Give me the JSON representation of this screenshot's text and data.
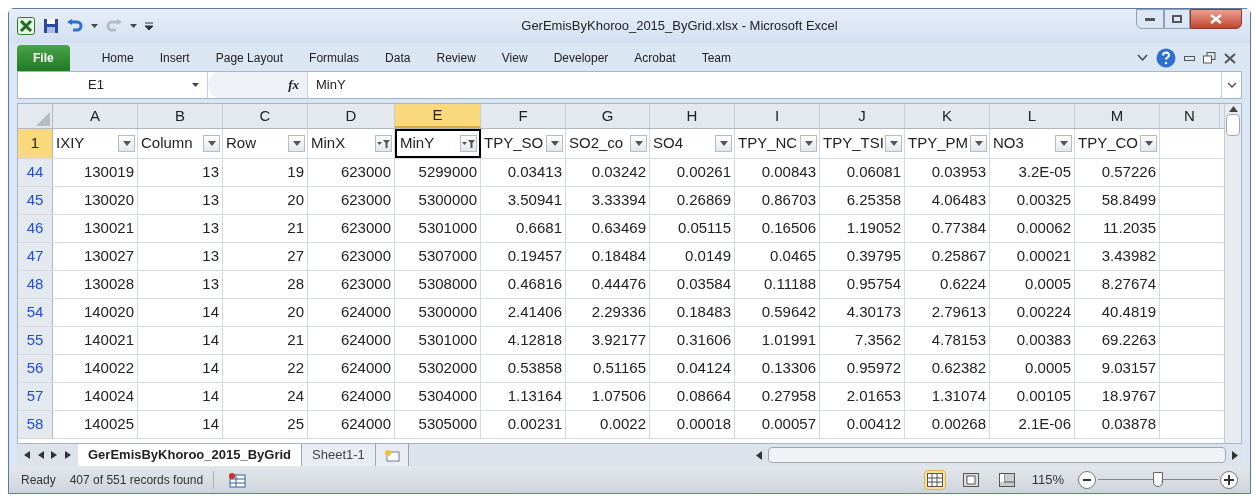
{
  "window": {
    "title": "GerEmisByKhoroo_2015_ByGrid.xlsx  -  Microsoft Excel"
  },
  "ribbon_tabs": [
    {
      "label": "File",
      "kind": "file",
      "selected": false
    },
    {
      "label": "Home",
      "kind": "tab",
      "selected": false
    },
    {
      "label": "Insert",
      "kind": "tab",
      "selected": false
    },
    {
      "label": "Page Layout",
      "kind": "tab",
      "selected": false
    },
    {
      "label": "Formulas",
      "kind": "tab",
      "selected": false
    },
    {
      "label": "Data",
      "kind": "tab",
      "selected": false
    },
    {
      "label": "Review",
      "kind": "tab",
      "selected": false
    },
    {
      "label": "View",
      "kind": "tab",
      "selected": false
    },
    {
      "label": "Developer",
      "kind": "tab",
      "selected": false
    },
    {
      "label": "Acrobat",
      "kind": "tab",
      "selected": false
    },
    {
      "label": "Team",
      "kind": "tab",
      "selected": false
    }
  ],
  "formula_bar": {
    "name_box": "E1",
    "fx": "fx",
    "value": "MinY"
  },
  "columns": [
    {
      "letter": "A",
      "selected": false
    },
    {
      "letter": "B",
      "selected": false
    },
    {
      "letter": "C",
      "selected": false
    },
    {
      "letter": "D",
      "selected": false
    },
    {
      "letter": "E",
      "selected": true
    },
    {
      "letter": "F",
      "selected": false
    },
    {
      "letter": "G",
      "selected": false
    },
    {
      "letter": "H",
      "selected": false
    },
    {
      "letter": "I",
      "selected": false
    },
    {
      "letter": "J",
      "selected": false
    },
    {
      "letter": "K",
      "selected": false
    },
    {
      "letter": "L",
      "selected": false
    },
    {
      "letter": "M",
      "selected": false
    },
    {
      "letter": "N",
      "selected": false
    }
  ],
  "header_row": {
    "number": "1",
    "fields": [
      {
        "label": "IXIY",
        "filtered": false,
        "selected": false
      },
      {
        "label": "Column",
        "filtered": false,
        "selected": false
      },
      {
        "label": "Row",
        "filtered": false,
        "selected": false
      },
      {
        "label": "MinX",
        "filtered": true,
        "selected": false
      },
      {
        "label": "MinY",
        "filtered": true,
        "selected": true
      },
      {
        "label": "TPY_SO",
        "filtered": false,
        "selected": false
      },
      {
        "label": "SO2_co",
        "filtered": false,
        "selected": false
      },
      {
        "label": "SO4",
        "filtered": false,
        "selected": false
      },
      {
        "label": "TPY_NC",
        "filtered": false,
        "selected": false
      },
      {
        "label": "TPY_TSI",
        "filtered": false,
        "selected": false
      },
      {
        "label": "TPY_PM",
        "filtered": false,
        "selected": false
      },
      {
        "label": "NO3",
        "filtered": false,
        "selected": false
      },
      {
        "label": "TPY_CO",
        "filtered": false,
        "selected": false
      }
    ]
  },
  "rows": [
    {
      "number": "44",
      "cells": [
        "130019",
        "13",
        "19",
        "623000",
        "5299000",
        "0.03413",
        "0.03242",
        "0.00261",
        "0.00843",
        "0.06081",
        "0.03953",
        "3.2E-05",
        "0.57226"
      ]
    },
    {
      "number": "45",
      "cells": [
        "130020",
        "13",
        "20",
        "623000",
        "5300000",
        "3.50941",
        "3.33394",
        "0.26869",
        "0.86703",
        "6.25358",
        "4.06483",
        "0.00325",
        "58.8499"
      ]
    },
    {
      "number": "46",
      "cells": [
        "130021",
        "13",
        "21",
        "623000",
        "5301000",
        "0.6681",
        "0.63469",
        "0.05115",
        "0.16506",
        "1.19052",
        "0.77384",
        "0.00062",
        "11.2035"
      ]
    },
    {
      "number": "47",
      "cells": [
        "130027",
        "13",
        "27",
        "623000",
        "5307000",
        "0.19457",
        "0.18484",
        "0.0149",
        "0.0465",
        "0.39795",
        "0.25867",
        "0.00021",
        "3.43982"
      ]
    },
    {
      "number": "48",
      "cells": [
        "130028",
        "13",
        "28",
        "623000",
        "5308000",
        "0.46816",
        "0.44476",
        "0.03584",
        "0.11188",
        "0.95754",
        "0.6224",
        "0.0005",
        "8.27674"
      ]
    },
    {
      "number": "54",
      "cells": [
        "140020",
        "14",
        "20",
        "624000",
        "5300000",
        "2.41406",
        "2.29336",
        "0.18483",
        "0.59642",
        "4.30173",
        "2.79613",
        "0.00224",
        "40.4819"
      ]
    },
    {
      "number": "55",
      "cells": [
        "140021",
        "14",
        "21",
        "624000",
        "5301000",
        "4.12818",
        "3.92177",
        "0.31606",
        "1.01991",
        "7.3562",
        "4.78153",
        "0.00383",
        "69.2263"
      ]
    },
    {
      "number": "56",
      "cells": [
        "140022",
        "14",
        "22",
        "624000",
        "5302000",
        "0.53858",
        "0.51165",
        "0.04124",
        "0.13306",
        "0.95972",
        "0.62382",
        "0.0005",
        "9.03157"
      ]
    },
    {
      "number": "57",
      "cells": [
        "140024",
        "14",
        "24",
        "624000",
        "5304000",
        "1.13164",
        "1.07506",
        "0.08664",
        "0.27958",
        "2.01653",
        "1.31074",
        "0.00105",
        "18.9767"
      ]
    },
    {
      "number": "58",
      "cells": [
        "140025",
        "14",
        "25",
        "624000",
        "5305000",
        "0.00231",
        "0.0022",
        "0.00018",
        "0.00057",
        "0.00412",
        "0.00268",
        "2.1E-06",
        "0.03878"
      ]
    }
  ],
  "sheet_tabs": [
    {
      "label": "GerEmisByKhoroo_2015_ByGrid",
      "selected": true
    },
    {
      "label": "Sheet1-1",
      "selected": false
    }
  ],
  "status_bar": {
    "mode": "Ready",
    "message": "407 of 551 records found",
    "views": [
      {
        "kind": "normal",
        "selected": true
      },
      {
        "kind": "page-layout",
        "selected": false
      },
      {
        "kind": "page-break",
        "selected": false
      }
    ],
    "zoom": "115%",
    "zoom_slider": {
      "level": 0.5
    }
  }
}
